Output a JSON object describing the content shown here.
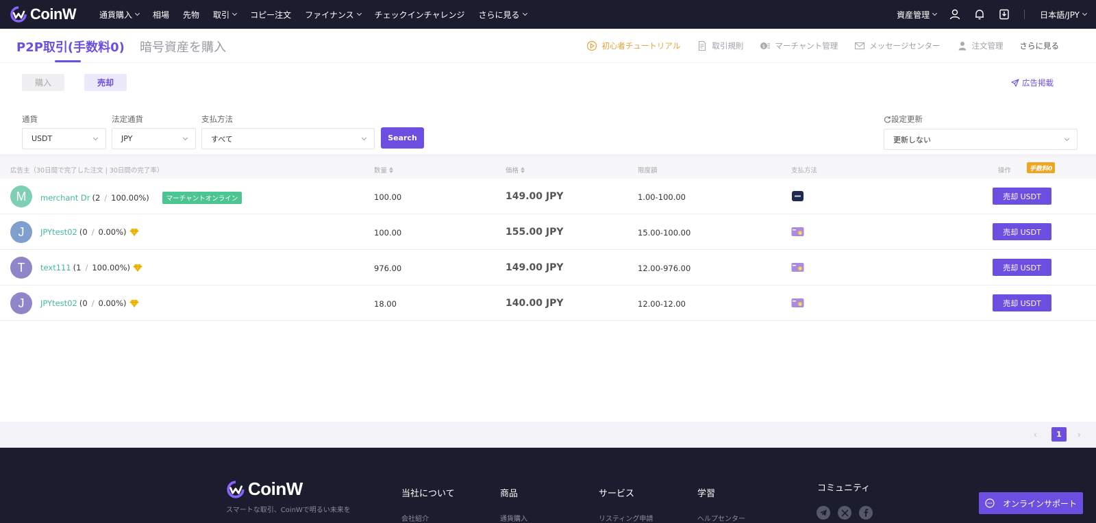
{
  "brand": {
    "name": "CoinW",
    "accent": "#6c4fe0"
  },
  "nav": {
    "items": [
      {
        "label": "通貨購入",
        "dropdown": true
      },
      {
        "label": "相場",
        "dropdown": false
      },
      {
        "label": "先物",
        "dropdown": false
      },
      {
        "label": "取引",
        "dropdown": true
      },
      {
        "label": "コピー注文",
        "dropdown": false
      },
      {
        "label": "ファイナンス",
        "dropdown": true
      },
      {
        "label": "チェックインチャレンジ",
        "dropdown": false
      },
      {
        "label": "さらに見る",
        "dropdown": true
      }
    ],
    "assets": "資産管理",
    "language": "日本語/JPY"
  },
  "subheader": {
    "tab_p2p": "P2P取引(手数料0)",
    "tab_buy": "暗号資産を購入",
    "links": {
      "tutorial": "初心者チュートリアル",
      "rules": "取引規則",
      "merchant": "マーチャント管理",
      "messages": "メッセージセンター",
      "orders": "注文管理",
      "more": "さらに見る"
    }
  },
  "toggle": {
    "buy": "購入",
    "sell": "売却"
  },
  "post_ad": "広告掲載",
  "filters": {
    "currency_label": "通貨",
    "currency_value": "USDT",
    "fiat_label": "法定通貨",
    "fiat_value": "JPY",
    "payment_label": "支払方法",
    "payment_value": "すべて",
    "search": "Search",
    "refresh_label": "設定更新",
    "refresh_value": "更新しない"
  },
  "table": {
    "headers": {
      "advertiser": "広告主（30日間で完了した注文 | 30日間の完了率）",
      "quantity": "数量",
      "price": "価格",
      "limit": "限度額",
      "payment": "支払方法",
      "action": "操作",
      "fee_badge": "手数料0"
    },
    "rows": [
      {
        "initial": "M",
        "avatar_color": "#7fcfb5",
        "name": "merchant Dr",
        "orders": "(2",
        "rate": "100.00%)",
        "badge": "マーチャントオンライン",
        "diamond": false,
        "quantity": "100.00",
        "price": "149.00 JPY",
        "limit": "1.00-100.00",
        "payment_icon": "bank-card-icon",
        "action": "売却 USDT"
      },
      {
        "initial": "J",
        "avatar_color": "#7f9fcf",
        "name": "JPYtest02",
        "orders": "(0",
        "rate": "0.00%)",
        "badge": "",
        "diamond": true,
        "quantity": "100.00",
        "price": "155.00 JPY",
        "limit": "15.00-100.00",
        "payment_icon": "cash-card-icon",
        "action": "売却 USDT"
      },
      {
        "initial": "T",
        "avatar_color": "#8f85c9",
        "name": "text111",
        "orders": "(1",
        "rate": "100.00%)",
        "badge": "",
        "diamond": true,
        "quantity": "976.00",
        "price": "149.00 JPY",
        "limit": "12.00-976.00",
        "payment_icon": "cash-card-icon",
        "action": "売却 USDT"
      },
      {
        "initial": "J",
        "avatar_color": "#8f85c9",
        "name": "JPYtest02",
        "orders": "(0",
        "rate": "0.00%)",
        "badge": "",
        "diamond": true,
        "quantity": "18.00",
        "price": "140.00 JPY",
        "limit": "12.00-12.00",
        "payment_icon": "cash-card-icon",
        "action": "売却 USDT"
      }
    ]
  },
  "pagination": {
    "prev": "‹",
    "current": "1",
    "next": "›"
  },
  "footer": {
    "tagline": "スマートな取引、CoinWで明るい未来を",
    "columns": [
      {
        "title": "当社について",
        "first": "会社紹介"
      },
      {
        "title": "商品",
        "first": "通貨購入"
      },
      {
        "title": "サービス",
        "first": "リスティング申請"
      },
      {
        "title": "学習",
        "first": "ヘルプセンター"
      }
    ],
    "community": "コミュニティ",
    "support": "オンラインサポート"
  }
}
